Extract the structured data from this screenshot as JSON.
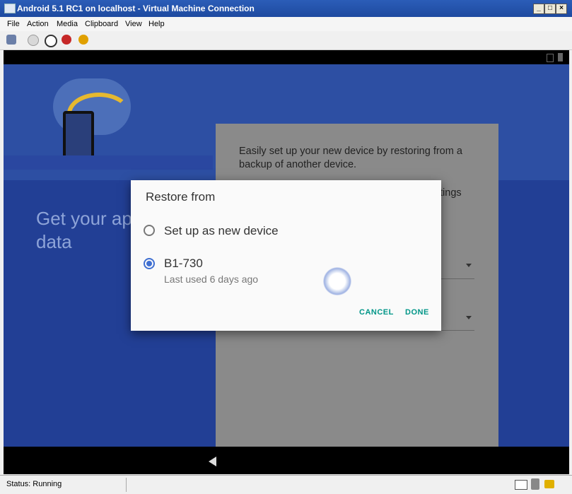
{
  "window": {
    "title": "Android 5.1 RC1 on localhost - Virtual Machine Connection"
  },
  "menu": [
    "File",
    "Action",
    "Media",
    "Clipboard",
    "View",
    "Help"
  ],
  "background_card": {
    "text1": "Easily set up your new device by restoring from a backup of another device.",
    "text2_partial": "ttings"
  },
  "welcome": {
    "heading_partial": "Get your ap\ndata"
  },
  "dialog": {
    "title": "Restore from",
    "options": [
      {
        "label": "Set up as new device",
        "sublabel": "",
        "selected": false
      },
      {
        "label": "B1-730",
        "sublabel": "Last used 6 days ago",
        "selected": true
      }
    ],
    "cancel": "CANCEL",
    "done": "DONE"
  },
  "status": {
    "text": "Status: Running"
  },
  "colors": {
    "accent": "#009688",
    "radio": "#3f6fd1",
    "bg_blue": "#2d4fa3"
  }
}
